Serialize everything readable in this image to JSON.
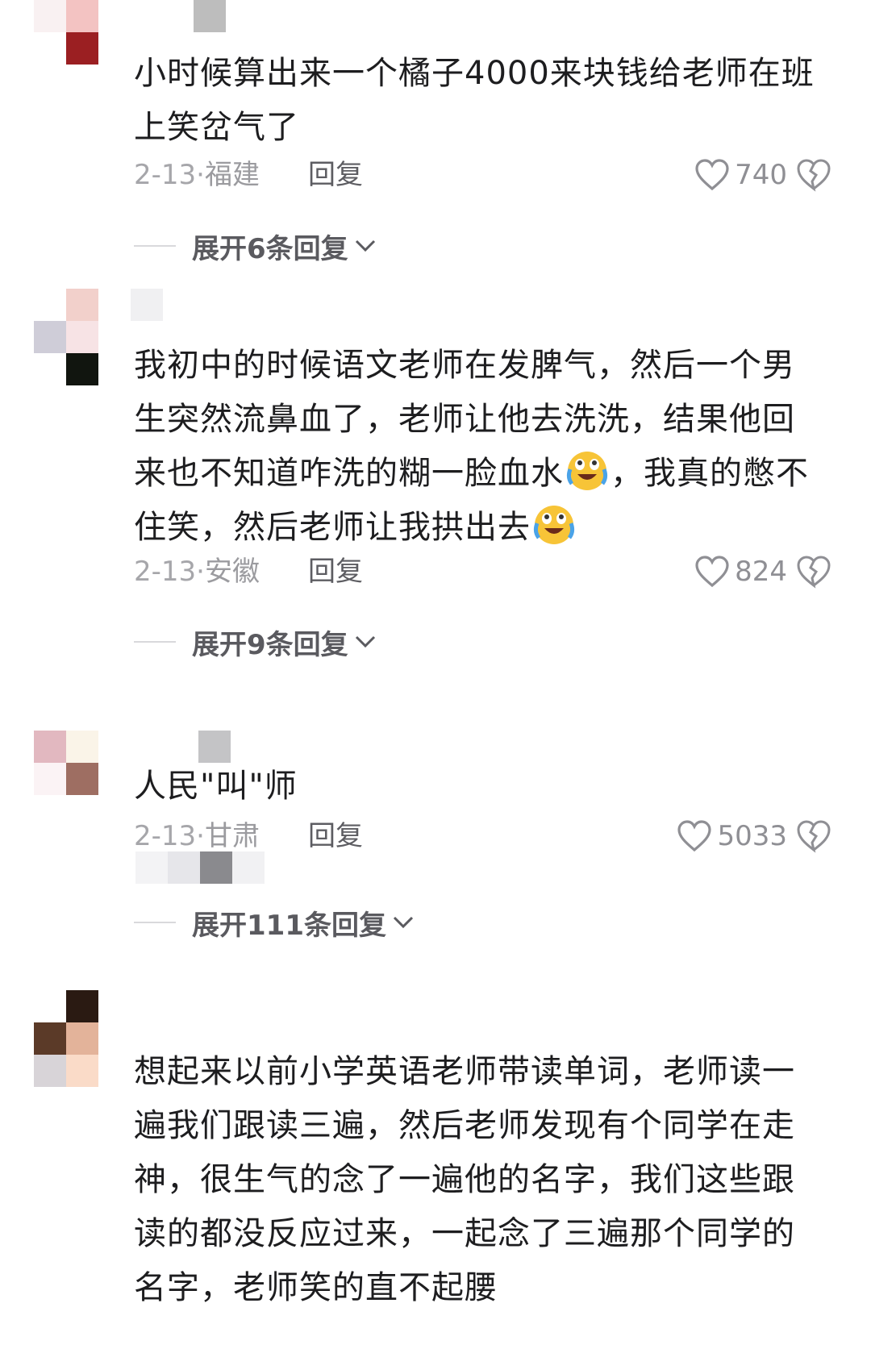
{
  "comments": [
    {
      "text_lines": [
        "小时候算出来一个橘子4000来块钱给老师在班",
        "上笑岔气了"
      ],
      "date": "2-13",
      "location": "福建",
      "reply_label": "回复",
      "likes": "740",
      "expand_label": "展开6条回复",
      "heart_icon": "heart-outline-icon",
      "dislike_icon": "broken-heart-icon"
    },
    {
      "text_lines": [
        "我初中的时候语文老师在发脾气，然后一个男",
        "生突然流鼻血了，老师让他去洗洗，结果他回",
        "来也不知道咋洗的糊一脸血水",
        "，我真的憋不",
        "住笑，然后老师让我拱出去"
      ],
      "date": "2-13",
      "location": "安徽",
      "reply_label": "回复",
      "likes": "824",
      "expand_label": "展开9条回复",
      "emoji_icon": "crying-laughing-emoji-icon"
    },
    {
      "text_lines": [
        "人民\"叫\"师"
      ],
      "date": "2-13",
      "location": "甘肃",
      "reply_label": "回复",
      "likes": "5033",
      "expand_label": "展开111条回复"
    },
    {
      "text_lines": [
        "想起来以前小学英语老师带读单词，老师读一",
        "遍我们跟读三遍，然后老师发现有个同学在走",
        "神，很生气的念了一遍他的名字，我们这些跟",
        "读的都没反应过来，一起念了三遍那个同学的",
        "名字，老师笑的直不起腰"
      ]
    }
  ],
  "colors": {
    "text": "#1d1d1f",
    "meta": "#9b9b9f",
    "reply": "#5d5d62",
    "expand": "#5a5a5f"
  }
}
